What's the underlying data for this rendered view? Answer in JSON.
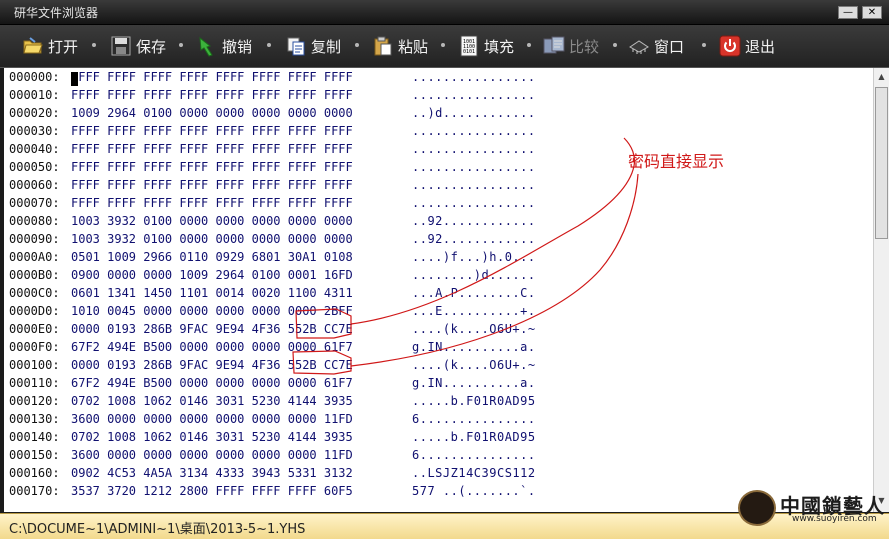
{
  "window": {
    "title": "研华文件浏览器",
    "minimize_glyph": "—",
    "close_glyph": "✕"
  },
  "toolbar": [
    {
      "key": "open",
      "label": "打开",
      "icon": "folder-open-icon",
      "enabled": true
    },
    {
      "key": "save",
      "label": "保存",
      "icon": "floppy-disk-icon",
      "enabled": true
    },
    {
      "key": "undo",
      "label": "撤销",
      "icon": "undo-arrow-icon",
      "enabled": true
    },
    {
      "key": "copy",
      "label": "复制",
      "icon": "copy-icon",
      "enabled": true
    },
    {
      "key": "paste",
      "label": "粘贴",
      "icon": "clipboard-icon",
      "enabled": true
    },
    {
      "key": "fill",
      "label": "填充",
      "icon": "binary-fill-icon",
      "enabled": true
    },
    {
      "key": "compare",
      "label": "比较",
      "icon": "compare-icon",
      "enabled": false
    },
    {
      "key": "window",
      "label": "窗口",
      "icon": "chip-icon",
      "enabled": true
    },
    {
      "key": "exit",
      "label": "退出",
      "icon": "power-icon",
      "enabled": true
    }
  ],
  "rows": [
    {
      "addr": "000000:",
      "hex": "FFFF FFFF FFFF FFFF FFFF FFFF FFFF FFFF",
      "ascii": "................"
    },
    {
      "addr": "000010:",
      "hex": "FFFF FFFF FFFF FFFF FFFF FFFF FFFF FFFF",
      "ascii": "................"
    },
    {
      "addr": "000020:",
      "hex": "1009 2964 0100 0000 0000 0000 0000 0000",
      "ascii": "..)d............"
    },
    {
      "addr": "000030:",
      "hex": "FFFF FFFF FFFF FFFF FFFF FFFF FFFF FFFF",
      "ascii": "................"
    },
    {
      "addr": "000040:",
      "hex": "FFFF FFFF FFFF FFFF FFFF FFFF FFFF FFFF",
      "ascii": "................"
    },
    {
      "addr": "000050:",
      "hex": "FFFF FFFF FFFF FFFF FFFF FFFF FFFF FFFF",
      "ascii": "................"
    },
    {
      "addr": "000060:",
      "hex": "FFFF FFFF FFFF FFFF FFFF FFFF FFFF FFFF",
      "ascii": "................"
    },
    {
      "addr": "000070:",
      "hex": "FFFF FFFF FFFF FFFF FFFF FFFF FFFF FFFF",
      "ascii": "................"
    },
    {
      "addr": "000080:",
      "hex": "1003 3932 0100 0000 0000 0000 0000 0000",
      "ascii": "..92............"
    },
    {
      "addr": "000090:",
      "hex": "1003 3932 0100 0000 0000 0000 0000 0000",
      "ascii": "..92............"
    },
    {
      "addr": "0000A0:",
      "hex": "0501 1009 2966 0110 0929 6801 30A1 0108",
      "ascii": "....)f...)h.0..."
    },
    {
      "addr": "0000B0:",
      "hex": "0900 0000 0000 1009 2964 0100 0001 16FD",
      "ascii": "........)d......"
    },
    {
      "addr": "0000C0:",
      "hex": "0601 1341 1450 1101 0014 0020 1100 4311",
      "ascii": "...A.P........C."
    },
    {
      "addr": "0000D0:",
      "hex": "1010 0045 0000 0000 0000 0000 0000 2BFF",
      "ascii": "...E..........+."
    },
    {
      "addr": "0000E0:",
      "hex": "0000 0193 286B 9FAC 9E94 4F36 552B CC7E",
      "ascii": "....(k....O6U+.~"
    },
    {
      "addr": "0000F0:",
      "hex": "67F2 494E B500 0000 0000 0000 0000 61F7",
      "ascii": "g.IN..........a."
    },
    {
      "addr": "000100:",
      "hex": "0000 0193 286B 9FAC 9E94 4F36 552B CC7E",
      "ascii": "....(k....O6U+.~"
    },
    {
      "addr": "000110:",
      "hex": "67F2 494E B500 0000 0000 0000 0000 61F7",
      "ascii": "g.IN..........a."
    },
    {
      "addr": "000120:",
      "hex": "0702 1008 1062 0146 3031 5230 4144 3935",
      "ascii": ".....b.F01R0AD95"
    },
    {
      "addr": "000130:",
      "hex": "3600 0000 0000 0000 0000 0000 0000 11FD",
      "ascii": "6..............."
    },
    {
      "addr": "000140:",
      "hex": "0702 1008 1062 0146 3031 5230 4144 3935",
      "ascii": ".....b.F01R0AD95"
    },
    {
      "addr": "000150:",
      "hex": "3600 0000 0000 0000 0000 0000 0000 11FD",
      "ascii": "6..............."
    },
    {
      "addr": "000160:",
      "hex": "0902 4C53 4A5A 3134 4333 3943 5331 3132",
      "ascii": "..LSJZ14C39CS112"
    },
    {
      "addr": "000170:",
      "hex": "3537 3720 1212 2800 FFFF FFFF FFFF 60F5",
      "ascii": "577 ..(.......`."
    }
  ],
  "annotation": {
    "text": "密码直接显示",
    "color": "#d01818"
  },
  "status": {
    "path": "C:\\DOCUME~1\\ADMINI~1\\桌面\\2013-5~1.YHS"
  },
  "watermark": {
    "title": "中國鎖藝人",
    "url": "www.suoyiren.com"
  },
  "colors": {
    "hex_text": "#101070",
    "status_bg": "#f7e4a4",
    "annotation_red": "#d01818"
  }
}
